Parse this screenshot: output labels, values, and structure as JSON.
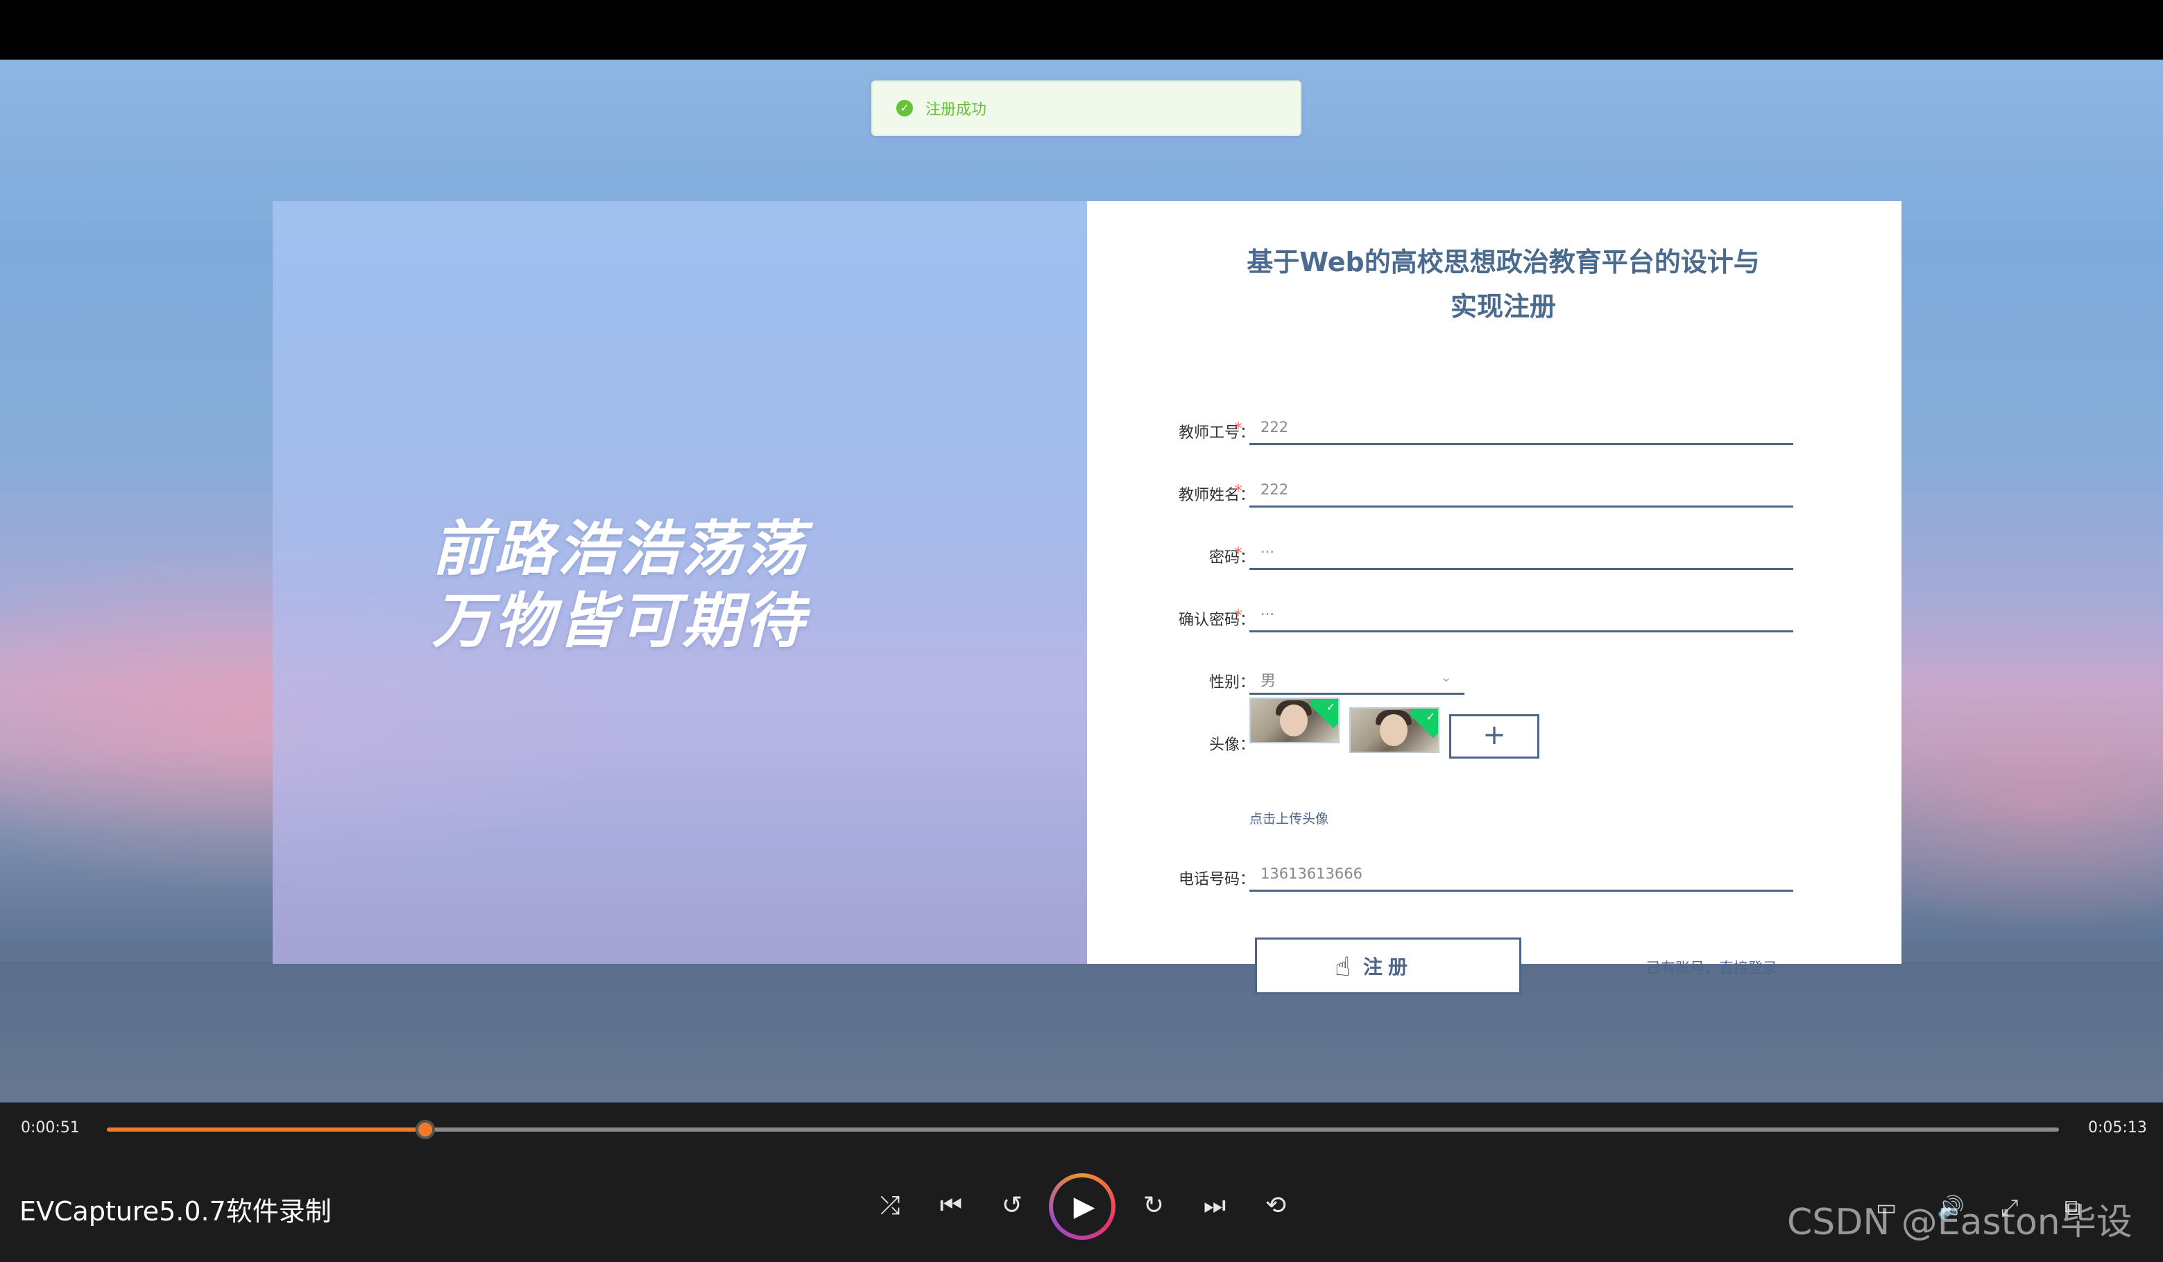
{
  "toast": {
    "icon": "success-check-icon",
    "text": "注册成功"
  },
  "left": {
    "slogan_line1": "前路浩浩荡荡",
    "slogan_line2": "万物皆可期待"
  },
  "form": {
    "title_line1": "基于Web的高校思想政治教育平台的设计与",
    "title_line2": "实现注册",
    "teacher_id": {
      "label": "教师工号：",
      "required_mark": "*",
      "value": "222"
    },
    "teacher_name": {
      "label": "教师姓名：",
      "required_mark": "*",
      "value": "222"
    },
    "password": {
      "label": "密码：",
      "required_mark": "*",
      "value": "···"
    },
    "confirm_password": {
      "label": "确认密码：",
      "required_mark": "*",
      "value": "···"
    },
    "gender": {
      "label": "性别：",
      "value": "男"
    },
    "avatar": {
      "label": "头像：",
      "upload_symbol": "+",
      "tip": "点击上传头像"
    },
    "phone": {
      "label": "电话号码：",
      "value": "13613613666"
    },
    "submit_label": "注册",
    "login_link": "已有账号，直接登录"
  },
  "player": {
    "current_time": "0:00:51",
    "total_time": "0:05:13",
    "progress": 0.163,
    "recorder_label": "EVCapture5.0.7软件录制",
    "watermark": "CSDN @Easton毕设",
    "accent_color": "#f07a2a"
  }
}
